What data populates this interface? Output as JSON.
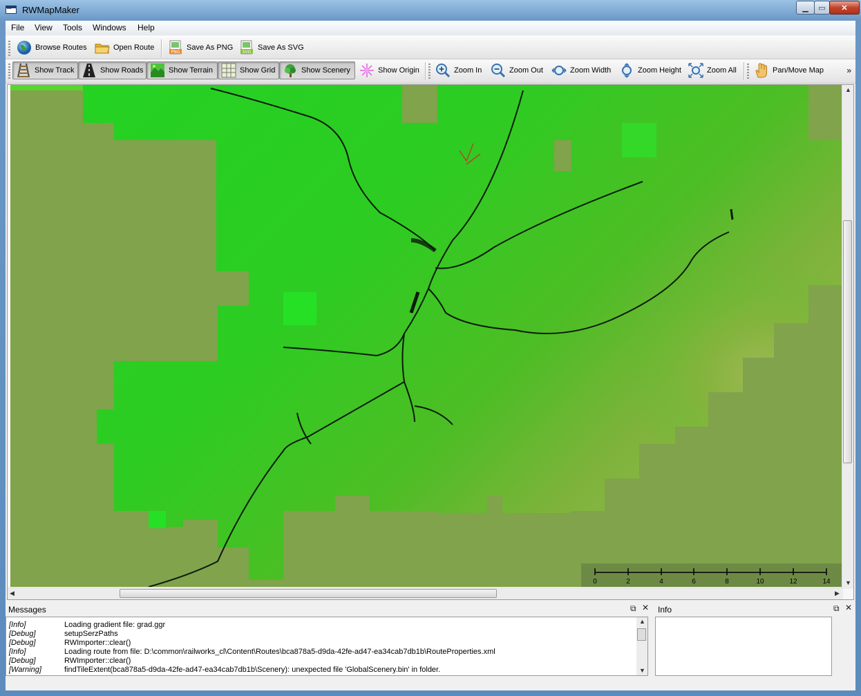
{
  "window": {
    "title": "RWMapMaker",
    "controls": [
      "min",
      "max",
      "close"
    ]
  },
  "menu": [
    "File",
    "View",
    "Tools",
    "Windows",
    "Help"
  ],
  "toolbar1": [
    {
      "label": "Browse Routes",
      "icon": "globe-icon"
    },
    {
      "label": "Open Route",
      "icon": "folder-icon"
    },
    {
      "label": "Save As PNG",
      "icon": "png-file-icon"
    },
    {
      "label": "Save As SVG",
      "icon": "svg-file-icon"
    }
  ],
  "toolbar2": [
    {
      "label": "Show Track",
      "icon": "track-icon",
      "checked": true
    },
    {
      "label": "Show Roads",
      "icon": "road-icon",
      "checked": true
    },
    {
      "label": "Show Terrain",
      "icon": "terrain-icon",
      "checked": true
    },
    {
      "label": "Show Grid",
      "icon": "grid-icon",
      "checked": true
    },
    {
      "label": "Show Scenery",
      "icon": "tree-icon",
      "checked": true
    },
    {
      "label": "Show Origin",
      "icon": "origin-star-icon",
      "checked": false
    },
    {
      "label": "Zoom In",
      "icon": "zoom-in-icon"
    },
    {
      "label": "Zoom Out",
      "icon": "zoom-out-icon"
    },
    {
      "label": "Zoom Width",
      "icon": "zoom-width-icon"
    },
    {
      "label": "Zoom Height",
      "icon": "zoom-height-icon"
    },
    {
      "label": "Zoom All",
      "icon": "zoom-all-icon"
    },
    {
      "label": "Pan/Move Map",
      "icon": "hand-icon"
    }
  ],
  "toolbar_overflow": "»",
  "scale_bar": {
    "ticks": [
      "0",
      "2",
      "4",
      "6",
      "8",
      "10",
      "12",
      "14"
    ]
  },
  "messages": {
    "title": "Messages",
    "rows": [
      {
        "level": "[Info]",
        "text": "Loading gradient file: grad.ggr"
      },
      {
        "level": "[Debug]",
        "text": "setupSerzPaths"
      },
      {
        "level": "[Debug]",
        "text": "RWImporter::clear()"
      },
      {
        "level": "[Info]",
        "text": "Loading route from file: D:\\common\\railworks_cl\\Content\\Routes\\bca878a5-d9da-42fe-ad47-ea34cab7db1b\\RouteProperties.xml"
      },
      {
        "level": "[Debug]",
        "text": "RWImporter::clear()"
      },
      {
        "level": "[Warning]",
        "text": "findTileExtent(bca878a5-d9da-42fe-ad47-ea34cab7db1b\\Scenery): unexpected file 'GlobalScenery.bin' in folder."
      }
    ]
  },
  "info": {
    "title": "Info"
  },
  "colors": {
    "terrain_low": "#1fd81f",
    "terrain_high": "#8fb13f",
    "background": "#7ea34c",
    "track": "#0a1a0a"
  }
}
